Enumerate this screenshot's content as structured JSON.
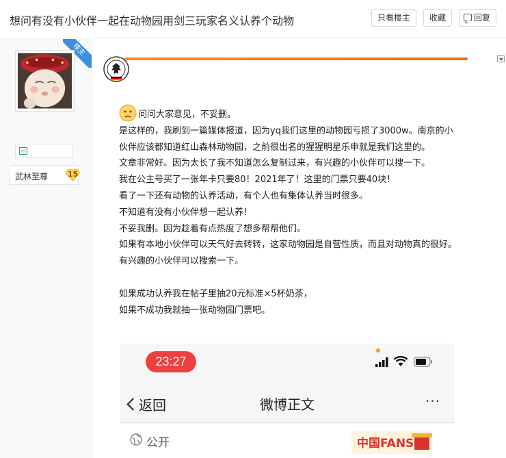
{
  "thread": {
    "title": "想问有没有小伙伴一起在动物园用剑三玩家名义认养个动物",
    "buttons": {
      "only_op": "只看楼主",
      "favorite": "收藏",
      "reply": "回复"
    }
  },
  "author": {
    "corner_badge": "楼主",
    "rank_name": "武林至尊",
    "level": "15"
  },
  "post": {
    "lines": [
      "问问大家意见，不妥删。",
      "是这样的，我刷到一篇媒体报道，因为yq我们这里的动物园亏损了3000w。南京的小伙伴应该都知道红山森林动物园，之前很出名的猩猩明星乐申就是我们这里的。",
      "文章非常好。因为太长了我不知道怎么复制过来，有兴趣的小伙伴可以搜一下。",
      "我在公主号买了一张年卡只要80！2021年了！这里的门票只要40块！",
      "看了一下还有动物的认养活动，有个人也有集体认养当时很多。",
      "不知道有没有小伙伴想一起认养！",
      "不妥我删。因为趁着有点热度了想多帮帮他们。",
      "如果有本地小伙伴可以天气好去转转，这家动物园是自营性质，而且对动物真的很好。有兴趣的小伙伴可以搜索一下。"
    ],
    "closing": [
      "如果成功认养我在帖子里抽20元标准×5杯奶茶，",
      "如果不成功我就抽一张动物园门票吧。"
    ]
  },
  "embedded_screenshot": {
    "time": "23:27",
    "back_label": "返回",
    "nav_title": "微博正文",
    "more": "···",
    "visibility": "公开",
    "fans_badge": "中国FANS"
  },
  "colors": {
    "accent_orange": "#ff7a1a",
    "corner_badge_blue": "#3d8fe0",
    "time_pill_red": "#ee4040"
  }
}
